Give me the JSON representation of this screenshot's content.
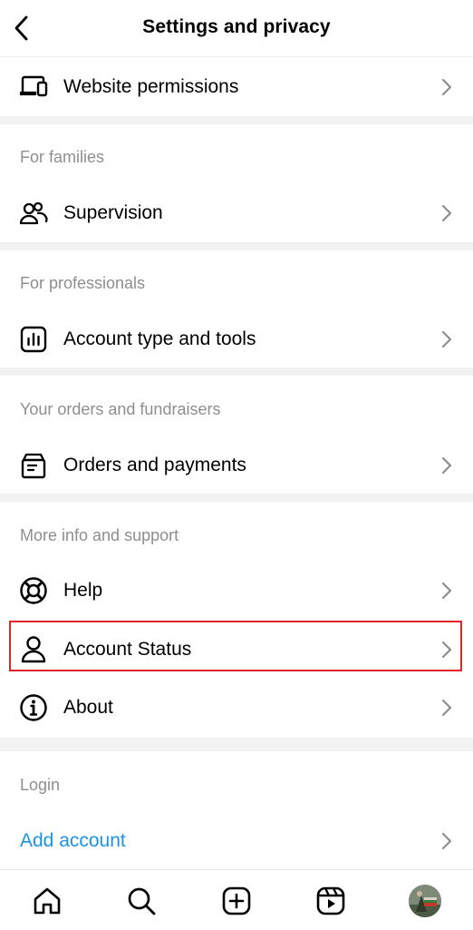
{
  "header": {
    "title": "Settings and privacy",
    "back_icon": "chevron-left-icon"
  },
  "rows": {
    "website_permissions": {
      "label": "Website permissions",
      "icon": "devices-icon"
    },
    "supervision": {
      "label": "Supervision",
      "icon": "people-icon"
    },
    "account_type": {
      "label": "Account type and tools",
      "icon": "chart-icon"
    },
    "orders": {
      "label": "Orders and payments",
      "icon": "orders-icon"
    },
    "help": {
      "label": "Help",
      "icon": "lifebuoy-icon"
    },
    "account_status": {
      "label": "Account Status",
      "icon": "person-icon"
    },
    "about": {
      "label": "About",
      "icon": "info-icon"
    },
    "add_account": {
      "label": "Add account"
    }
  },
  "sections": {
    "families": "For families",
    "professionals": "For professionals",
    "orders": "Your orders and fundraisers",
    "support": "More info and support",
    "login": "Login"
  },
  "tabbar": [
    "home-icon",
    "search-icon",
    "create-icon",
    "reels-icon",
    "profile-avatar"
  ],
  "colors": {
    "link_blue": "#1a93e6",
    "highlight_red": "#e0252c",
    "section_gray": "#8e8e8e",
    "separator": "#f2f2f2"
  }
}
